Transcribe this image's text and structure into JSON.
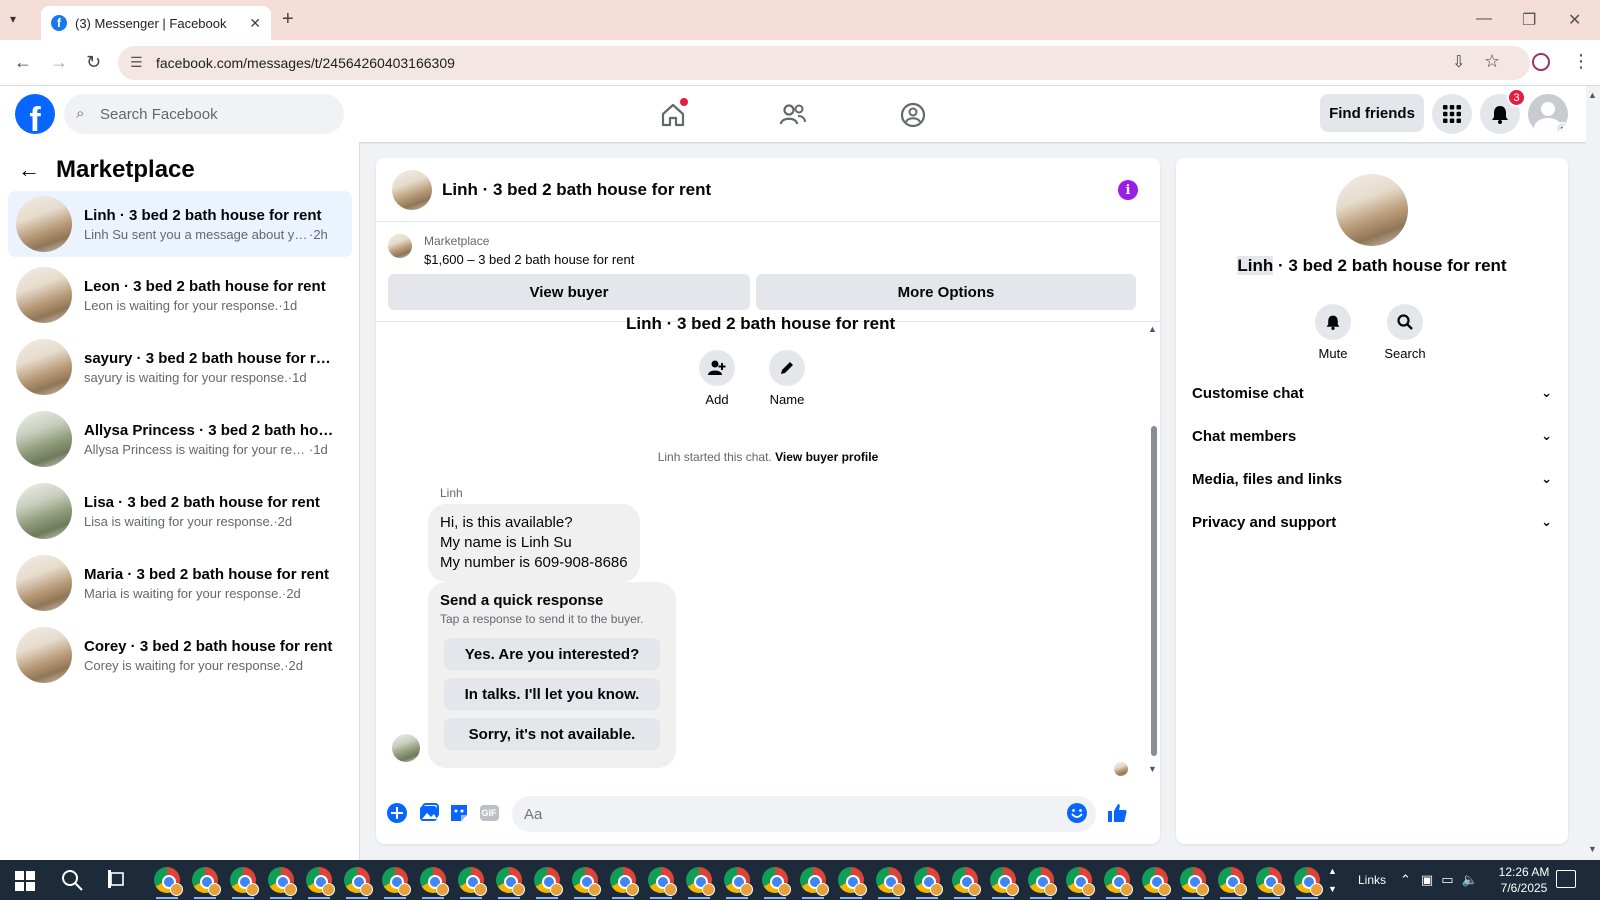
{
  "browser": {
    "tab_title": "(3) Messenger | Facebook",
    "url": "facebook.com/messages/t/24564260403166309"
  },
  "header": {
    "search_placeholder": "Search Facebook",
    "find_friends": "Find friends",
    "notification_count": "3",
    "colors": {
      "brand": "#0866ff",
      "badge": "#e41e3f"
    }
  },
  "sidebar": {
    "title": "Marketplace",
    "conversations": [
      {
        "name": "Linh · 3 bed 2 bath house for rent",
        "preview": "Linh Su sent you a message about yo...",
        "time": "·2h",
        "active": true
      },
      {
        "name": "Leon · 3 bed 2 bath house for rent",
        "preview": "Leon is waiting for your response.",
        "time": "·1d"
      },
      {
        "name": "sayury · 3 bed 2 bath house for rent",
        "preview": "sayury is waiting for your response.",
        "time": "·1d"
      },
      {
        "name": "Allysa Princess · 3 bed 2 bath hous...",
        "preview": "Allysa Princess is waiting for your res...",
        "time": "·1d"
      },
      {
        "name": "Lisa · 3 bed 2 bath house for rent",
        "preview": "Lisa is waiting for your response.",
        "time": "·2d"
      },
      {
        "name": "Maria · 3 bed 2 bath house for rent",
        "preview": "Maria is waiting for your response.",
        "time": "·2d"
      },
      {
        "name": "Corey · 3 bed 2 bath house for rent",
        "preview": "Corey is waiting for your response.",
        "time": "·2d"
      }
    ]
  },
  "chat": {
    "title": "Linh · 3 bed 2 bath house for rent",
    "marketplace_label": "Marketplace",
    "listing": "$1,600 – 3 bed 2 bath house for rent",
    "view_buyer": "View buyer",
    "more_options": "More Options",
    "cutoff_title": "Linh · 3 bed 2 bath house for rent",
    "actions": {
      "add": "Add",
      "name": "Name"
    },
    "started_text": "Linh started this chat.",
    "view_buyer_profile": "View buyer profile",
    "sender": "Linh",
    "message_lines": [
      "Hi, is this available?",
      "My name is Linh Su",
      "My number is 609-908-8686"
    ],
    "quick_response": {
      "title": "Send a quick response",
      "subtitle": "Tap a response to send it to the buyer.",
      "options": [
        "Yes. Are you interested?",
        "In talks. I'll let you know.",
        "Sorry, it's not available."
      ]
    },
    "input_placeholder": "Aa",
    "gif_label": "GIF"
  },
  "info_panel": {
    "name_highlight": "Linh",
    "title_rest": " · 3 bed 2 bath house for rent",
    "mute": "Mute",
    "search": "Search",
    "sections": [
      "Customise chat",
      "Chat members",
      "Media, files and links",
      "Privacy and support"
    ]
  },
  "taskbar": {
    "links_label": "Links",
    "time": "12:26 AM",
    "date": "7/6/2025"
  }
}
